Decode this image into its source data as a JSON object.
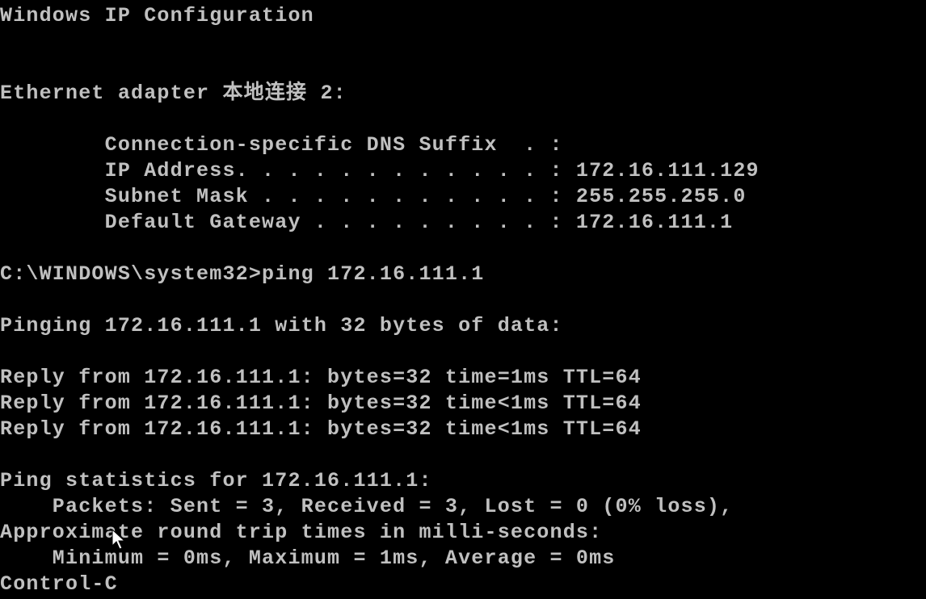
{
  "colors": {
    "background": "#000000",
    "foreground": "#c0c0c0"
  },
  "console": {
    "lines": [
      "Windows IP Configuration",
      "",
      "",
      "Ethernet adapter 本地连接 2:",
      "",
      "        Connection-specific DNS Suffix  . :",
      "        IP Address. . . . . . . . . . . . : 172.16.111.129",
      "        Subnet Mask . . . . . . . . . . . : 255.255.255.0",
      "        Default Gateway . . . . . . . . . : 172.16.111.1",
      "",
      "C:\\WINDOWS\\system32>ping 172.16.111.1",
      "",
      "Pinging 172.16.111.1 with 32 bytes of data:",
      "",
      "Reply from 172.16.111.1: bytes=32 time=1ms TTL=64",
      "Reply from 172.16.111.1: bytes=32 time<1ms TTL=64",
      "Reply from 172.16.111.1: bytes=32 time<1ms TTL=64",
      "",
      "Ping statistics for 172.16.111.1:",
      "    Packets: Sent = 3, Received = 3, Lost = 0 (0% loss),",
      "Approximate round trip times in milli-seconds:",
      "    Minimum = 0ms, Maximum = 1ms, Average = 0ms",
      "Control-C"
    ]
  },
  "cursor": {
    "icon": "mouse-pointer-icon"
  }
}
